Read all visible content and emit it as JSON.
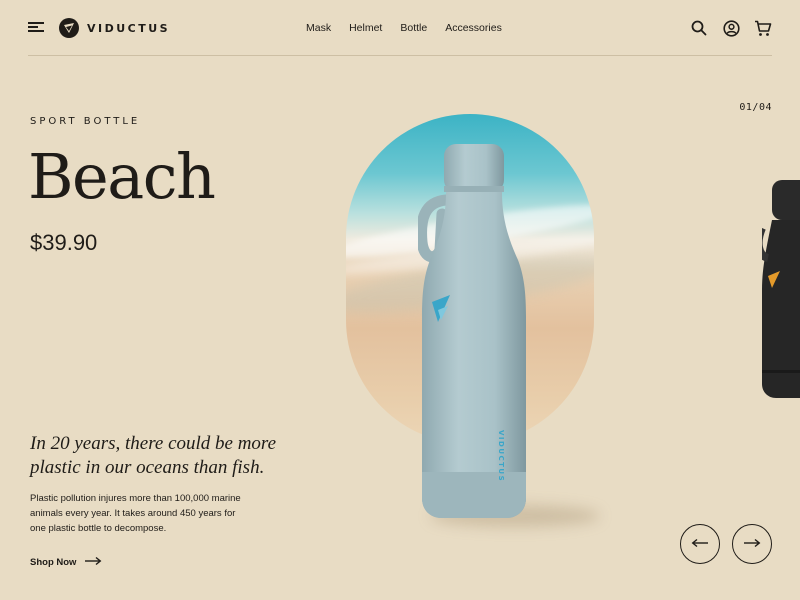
{
  "brand": {
    "name": "VIDUCTUS"
  },
  "nav": {
    "items": [
      {
        "label": "Mask"
      },
      {
        "label": "Helmet"
      },
      {
        "label": "Bottle"
      },
      {
        "label": "Accessories"
      }
    ]
  },
  "icons": {
    "menu": "menu-icon",
    "search": "search-icon",
    "account": "user-icon",
    "cart": "cart-icon"
  },
  "product": {
    "category": "SPORT BOTTLE",
    "name": "Beach",
    "price": "$39.90",
    "bottle_label": "VIDUCTUS"
  },
  "slider": {
    "counter": "01/04"
  },
  "story": {
    "quote": "In 20 years, there could be more plastic in our oceans than fish.",
    "description": "Plastic pollution injures more than 100,000 marine animals every year. It takes around 450 years for one plastic bottle to decompose."
  },
  "cta": {
    "shop_label": "Shop Now"
  },
  "colors": {
    "background": "#e8dcc4",
    "text": "#1f1c18",
    "bottle_body": "#a9c2c8",
    "accent": "#3aa6c9",
    "next_bottle": "#262626",
    "next_accent": "#e49a2a"
  }
}
